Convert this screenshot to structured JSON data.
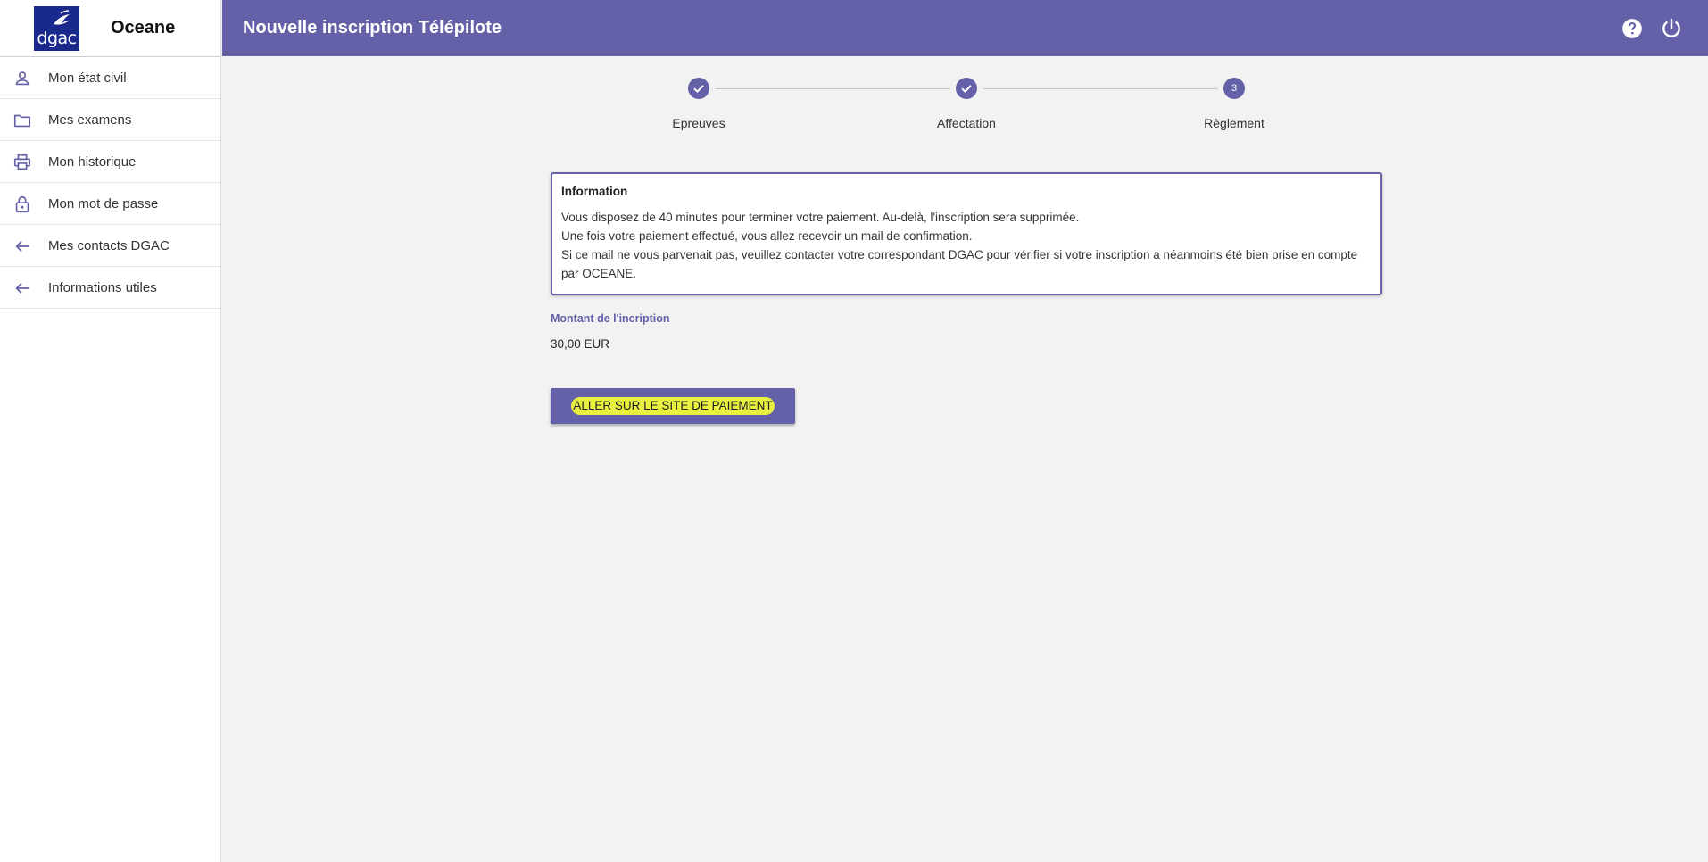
{
  "sidebar": {
    "logo_text": "dgac",
    "app_name": "Oceane",
    "items": [
      {
        "label": "Mon état civil",
        "icon": "person-icon"
      },
      {
        "label": "Mes examens",
        "icon": "folder-icon"
      },
      {
        "label": "Mon historique",
        "icon": "printer-icon"
      },
      {
        "label": "Mon mot de passe",
        "icon": "lock-icon"
      },
      {
        "label": "Mes contacts DGAC",
        "icon": "arrow-left-icon"
      },
      {
        "label": "Informations utiles",
        "icon": "arrow-left-icon"
      }
    ]
  },
  "header": {
    "title": "Nouvelle inscription Télépilote",
    "icons": [
      "help-icon",
      "power-icon"
    ]
  },
  "stepper": {
    "steps": [
      {
        "label": "Epreuves",
        "state": "completed",
        "number": ""
      },
      {
        "label": "Affectation",
        "state": "completed",
        "number": ""
      },
      {
        "label": "Règlement",
        "state": "active",
        "number": "3"
      }
    ]
  },
  "info": {
    "title": "Information",
    "lines": [
      "Vous disposez de 40 minutes pour terminer votre paiement. Au-delà, l'inscription sera supprimée.",
      "Une fois votre paiement effectué, vous allez recevoir un mail de confirmation.",
      "Si ce mail ne vous parvenait pas, veuillez contacter votre correspondant DGAC pour vérifier si votre inscription a néanmoins été bien prise en compte par OCEANE."
    ]
  },
  "amount": {
    "label": "Montant de l'incription",
    "value": "30,00 EUR"
  },
  "pay_button": {
    "label": "ALLER SUR LE SITE DE PAIEMENT"
  },
  "colors": {
    "primary": "#6561a8",
    "logo_bg": "#1a2a8c",
    "background": "#f2f2f2",
    "highlight": "#e8f040"
  }
}
